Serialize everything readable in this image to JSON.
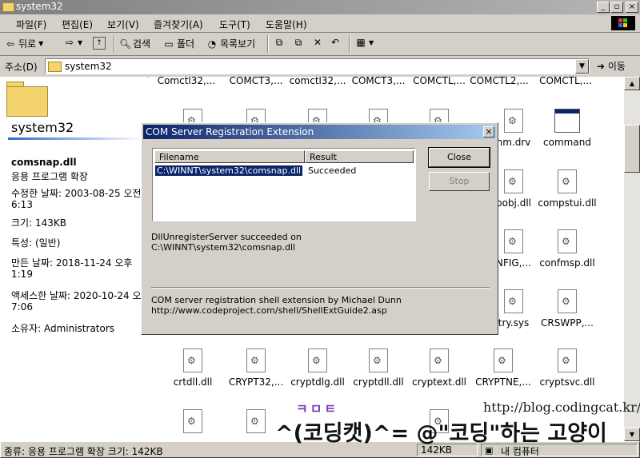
{
  "window": {
    "title": "system32"
  },
  "menu": [
    "파일(F)",
    "편집(E)",
    "보기(V)",
    "즐겨찾기(A)",
    "도구(T)",
    "도움말(H)"
  ],
  "toolbar": {
    "back": "뒤로",
    "search": "검색",
    "folders": "폴더",
    "history": "목록보기"
  },
  "address": {
    "label": "주소(D)",
    "value": "system32",
    "go": "이동"
  },
  "left_pane": {
    "folder_title": "system32",
    "file_name": "comsnap.dll",
    "file_type": "응용 프로그램 확장",
    "modified_1": "수정한 날짜: 2003-08-25 오전",
    "modified_2": "6:13",
    "size": "크기: 143KB",
    "attributes": "특성: (일반)",
    "created_1": "만든 날짜: 2018-11-24 오후",
    "created_2": "1:19",
    "accessed_1": "액세스한 날짜: 2020-10-24 오",
    "accessed_2": "7:06",
    "owner": "소유자: Administrators"
  },
  "files": {
    "top_row": [
      "Comctl32,...",
      "COMCT3,...",
      "comctl32,...",
      "COMCT3,...",
      "COMCTL,...",
      "COMCTL2,...",
      "COMCTL,..."
    ],
    "r1_right": [
      "nm.drv",
      "command"
    ],
    "r2_right": [
      "bobj.dll",
      "compstui.dll"
    ],
    "r3_right": [
      "NFIG,...",
      "confmsp.dll"
    ],
    "r4_right": [
      "try.sys",
      "CRSWPP,..."
    ],
    "r5": [
      "crtdll.dll",
      "CRYPT32,...",
      "cryptdlg.dll",
      "cryptdll.dll",
      "cryptext.dll",
      "CRYPTNE,...",
      "cryptsvc.dll"
    ]
  },
  "status": {
    "text": "종류: 응용 프로그램 확장 크기: 142KB",
    "size_panel": "142KB",
    "zone": "내 컴퓨터"
  },
  "dialog": {
    "title": "COM Server Registration Extension",
    "col_filename": "Filename",
    "col_result": "Result",
    "row_file": "C:\\WINNT\\system32\\comsnap.dll",
    "row_result": "Succeeded",
    "close": "Close",
    "stop": "Stop",
    "message_1": "DllUnregisterServer succeeded on",
    "message_2": "C:\\WINNT\\system32\\comsnap.dll",
    "credit_1": "COM server registration shell extension by Michael Dunn",
    "credit_2": "http://www.codeproject.com/shell/ShellExtGuide2.asp"
  },
  "watermark": {
    "url": "http://blog.codingcat.kr/",
    "caption": "^(코딩캣)^= @\"코딩\"하는 고양이"
  },
  "colors": {
    "dialog_title": "#0a246a",
    "selection": "#0a246a",
    "chrome": "#d4d0c8"
  }
}
